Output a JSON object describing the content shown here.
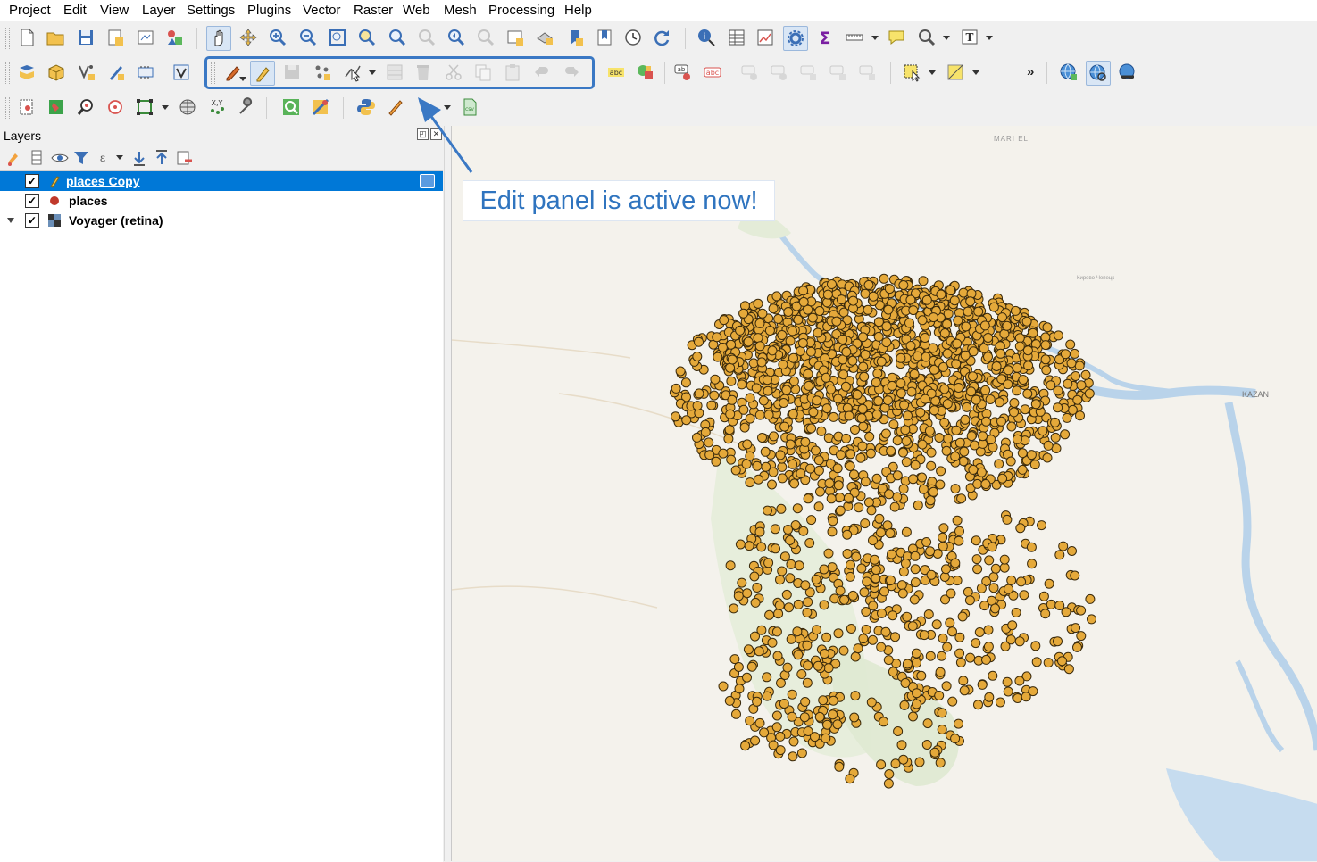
{
  "menubar": {
    "items": [
      "Project",
      "Edit",
      "View",
      "Layer",
      "Settings",
      "Plugins",
      "Vector",
      "Raster",
      "Web",
      "Mesh",
      "Processing",
      "Help"
    ]
  },
  "toolbar2": {
    "more_label": "»"
  },
  "layers_panel": {
    "title": "Layers",
    "layers": [
      {
        "name": "places Copy",
        "checked": "✓",
        "selected": true
      },
      {
        "name": "places",
        "checked": "✓",
        "selected": false
      },
      {
        "name": "Voyager (retina)",
        "checked": "✓",
        "selected": false
      }
    ]
  },
  "map": {
    "labels": [
      "MARI EL",
      "KAZAN",
      "Кирово-Чепецк"
    ],
    "point_color": "#e5a93a",
    "point_stroke": "#3a2a0c"
  },
  "annotation": {
    "text": "Edit panel is active now!",
    "color": "#2f74bf"
  },
  "colors": {
    "selection": "#0078d7",
    "highlight": "#3a78c4"
  }
}
